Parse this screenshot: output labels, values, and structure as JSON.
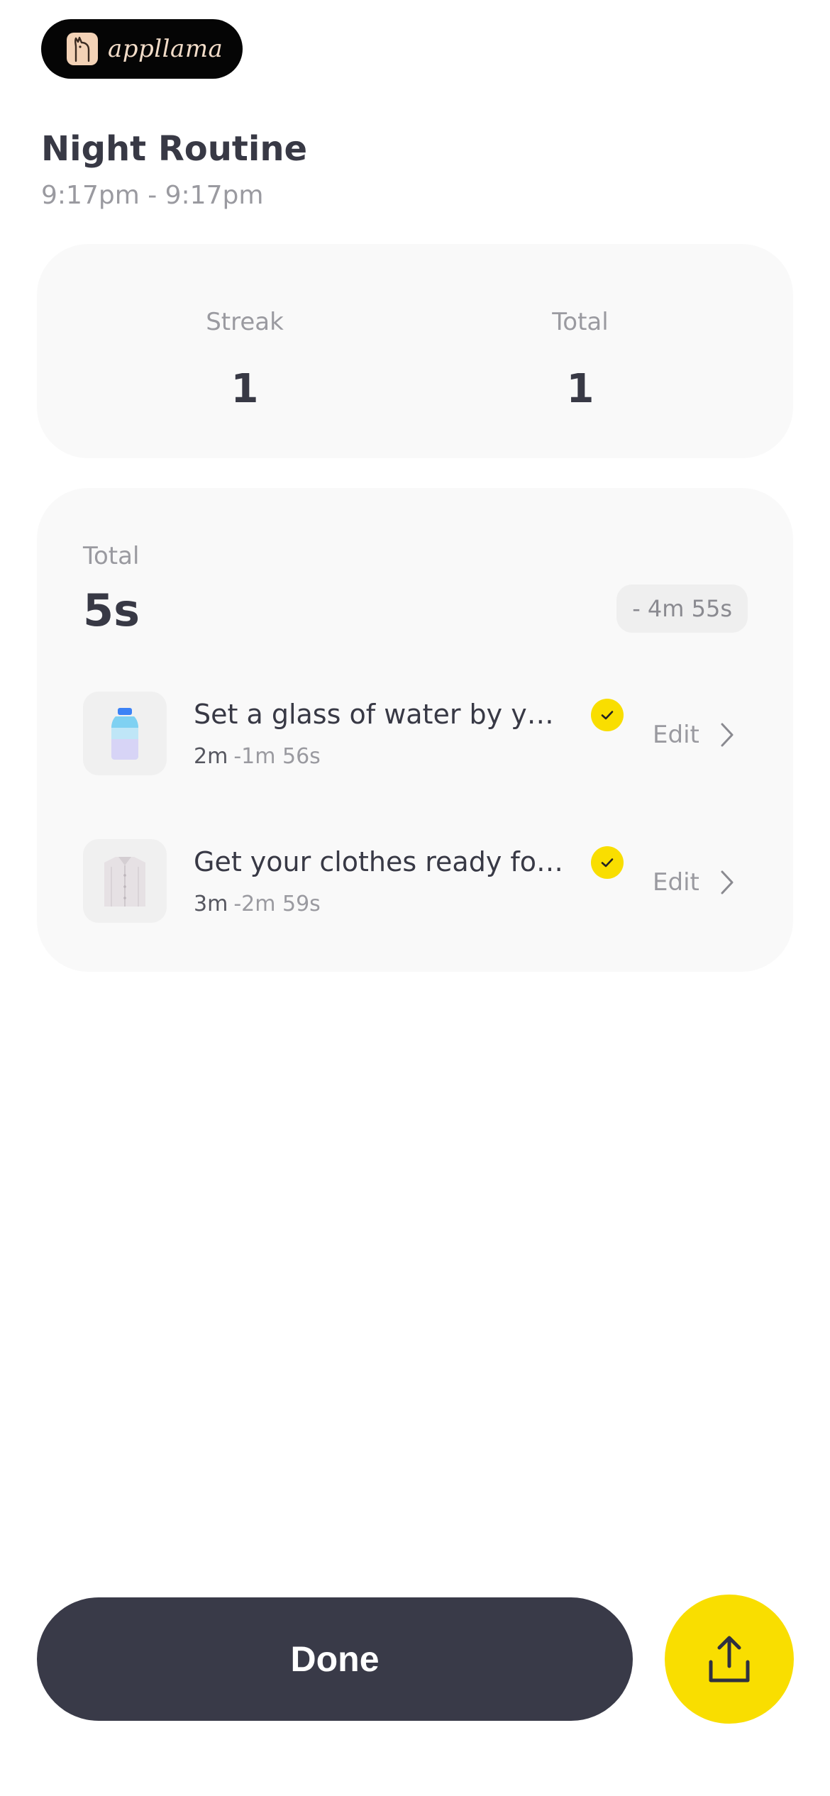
{
  "brand": {
    "name": "appllama",
    "logo_icon": "llama-icon"
  },
  "header": {
    "title": "Night Routine",
    "time_range": "9:17pm - 9:17pm"
  },
  "stats": {
    "streak_label": "Streak",
    "streak_value": "1",
    "total_label": "Total",
    "total_value": "1"
  },
  "summary": {
    "total_label": "Total",
    "total_value": "5s",
    "difference": "- 4m 55s"
  },
  "tasks": [
    {
      "name": "Set a glass of water by your...",
      "duration": "2m",
      "delta": "-1m 56s",
      "completed": true,
      "icon": "water-bottle-icon",
      "edit_label": "Edit"
    },
    {
      "name": "Get your clothes ready for t...",
      "duration": "3m",
      "delta": "-2m 59s",
      "completed": true,
      "icon": "shirt-icon",
      "edit_label": "Edit"
    }
  ],
  "actions": {
    "done_label": "Done",
    "share_icon": "share-icon"
  },
  "colors": {
    "accent": "#f9de00",
    "dark": "#393a48",
    "card": "#f9f9f9",
    "muted": "#9a9aa0"
  }
}
